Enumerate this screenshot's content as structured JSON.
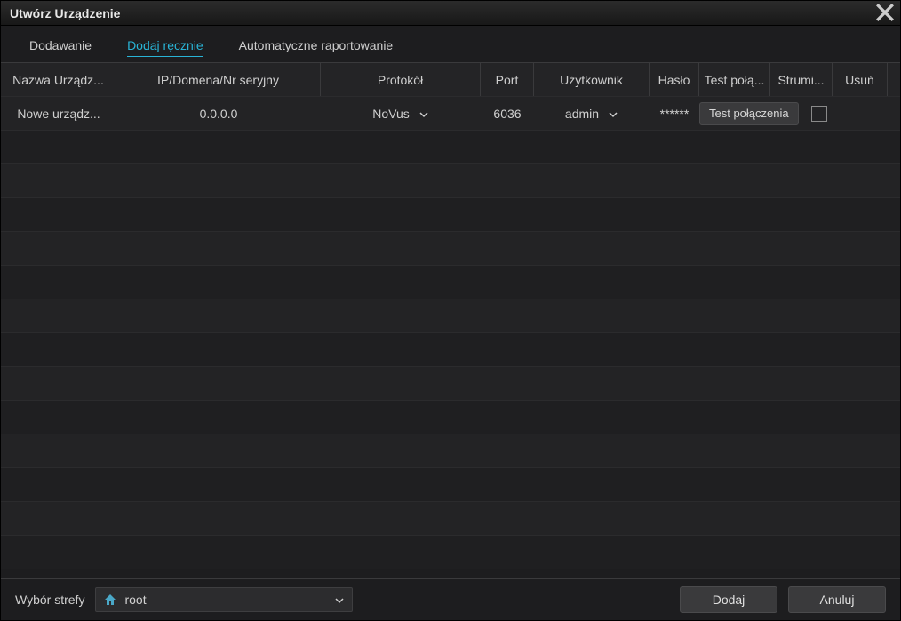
{
  "window": {
    "title": "Utwórz Urządzenie"
  },
  "tabs": [
    {
      "label": "Dodawanie",
      "active": false
    },
    {
      "label": "Dodaj ręcznie",
      "active": true
    },
    {
      "label": "Automatyczne raportowanie",
      "active": false
    }
  ],
  "columns": {
    "name": "Nazwa Urządz...",
    "ip": "IP/Domena/Nr seryjny",
    "protocol": "Protokół",
    "port": "Port",
    "user": "Użytkownik",
    "password": "Hasło",
    "test": "Test połą...",
    "stream": "Strumi...",
    "delete": "Usuń"
  },
  "row": {
    "name": "Nowe urządz...",
    "ip": "0.0.0.0",
    "protocol": "NoVus",
    "port": "6036",
    "user": "admin",
    "password": "******",
    "test_label": "Test połączenia"
  },
  "footer": {
    "zone_label": "Wybór strefy",
    "zone_value": "root",
    "add": "Dodaj",
    "cancel": "Anuluj"
  }
}
